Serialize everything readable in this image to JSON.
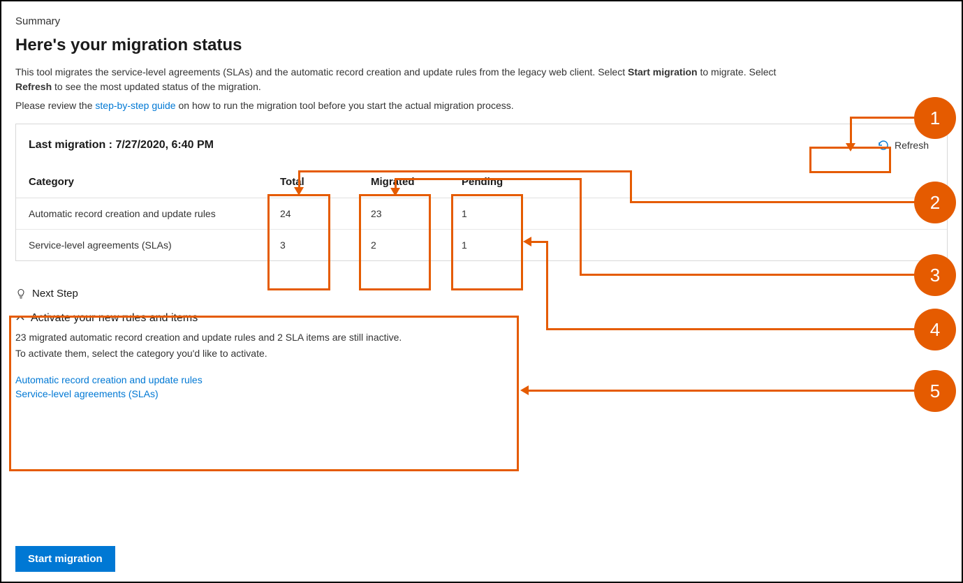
{
  "header": {
    "summary_label": "Summary",
    "title": "Here's your migration status",
    "description_pre": "This tool migrates the service-level agreements (SLAs) and the automatic record creation and update rules from the legacy web client. Select ",
    "description_bold1": "Start migration",
    "description_mid": " to migrate. Select ",
    "description_bold2": "Refresh",
    "description_post": " to see the most updated status of the migration.",
    "guide_pre": "Please review the ",
    "guide_link": "step-by-step guide",
    "guide_post": " on how to run the migration tool before you start the actual migration process."
  },
  "card": {
    "last_migration_label": "Last migration : 7/27/2020, 6:40 PM",
    "refresh_label": "Refresh",
    "columns": {
      "category": "Category",
      "total": "Total",
      "migrated": "Migrated",
      "pending": "Pending"
    },
    "rows": [
      {
        "category": "Automatic record creation and update rules",
        "total": "24",
        "migrated": "23",
        "pending": "1"
      },
      {
        "category": "Service-level agreements (SLAs)",
        "total": "3",
        "migrated": "2",
        "pending": "1"
      }
    ]
  },
  "next_step": {
    "label": "Next Step",
    "activate_title": "Activate your new rules and items",
    "line1": "23 migrated automatic record creation and update rules and 2 SLA items are still inactive.",
    "line2": "To activate them, select the category you'd like to activate.",
    "link1": "Automatic record creation and update rules",
    "link2": "Service-level agreements (SLAs)"
  },
  "start_button": "Start migration",
  "annotations": {
    "c1": "1",
    "c2": "2",
    "c3": "3",
    "c4": "4",
    "c5": "5"
  }
}
